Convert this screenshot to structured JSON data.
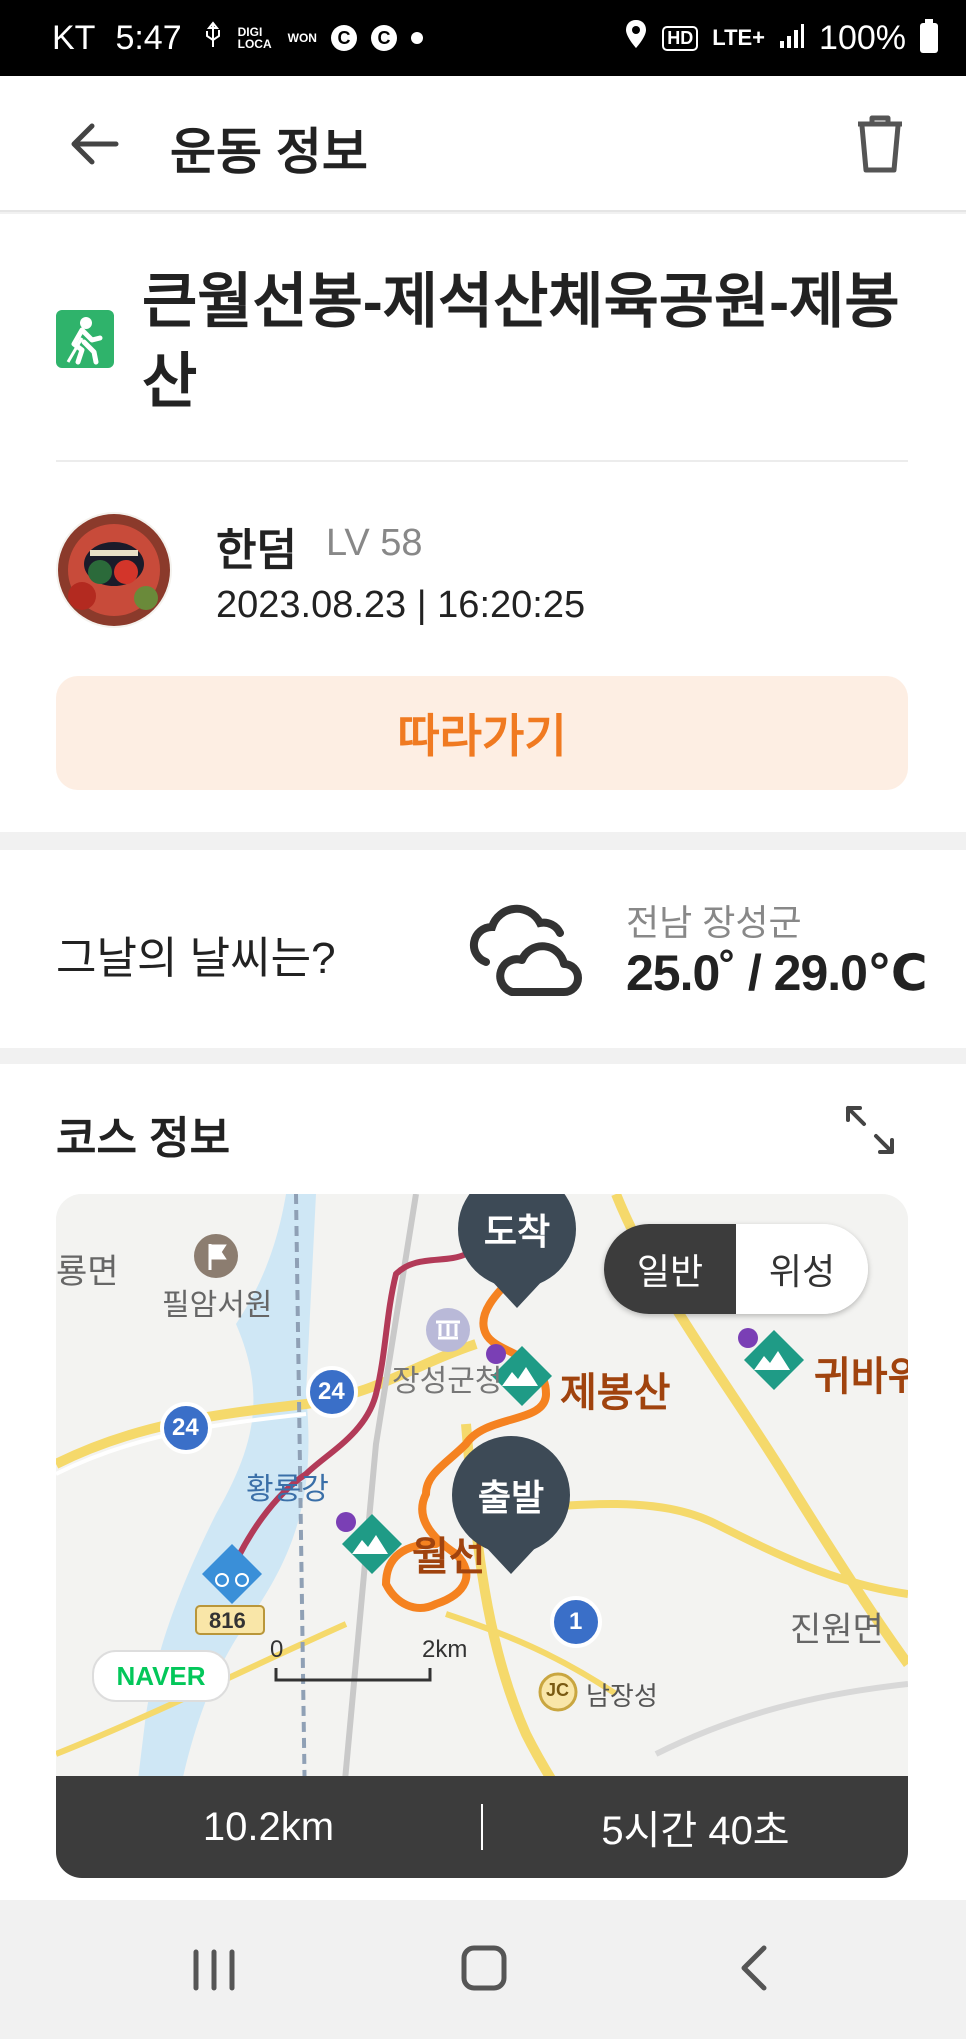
{
  "status_bar": {
    "carrier": "KT",
    "time": "5:47",
    "indicators": [
      "usb-icon",
      "digi-loca-icon",
      "won-icon",
      "c-icon",
      "c-icon"
    ],
    "c_badge": "C",
    "digi_loca": "DIGI LOCA",
    "won": "WON",
    "hd": "HD",
    "network": "LTE+",
    "battery": "100%"
  },
  "header": {
    "title": "운동 정보"
  },
  "activity": {
    "title": "큰월선봉-제석산체육공원-제봉산",
    "user": {
      "name": "한덤",
      "level": "LV 58",
      "datetime": "2023.08.23 | 16:20:25"
    },
    "follow_label": "따라가기"
  },
  "weather": {
    "question": "그날의 날씨는?",
    "location": "전남 장성군",
    "temperature": "25.0˚ / 29.0℃",
    "icon": "cloud-icon"
  },
  "course": {
    "title": "코스 정보",
    "map_toggle": {
      "normal": "일반",
      "satellite": "위성",
      "selected": "일반"
    },
    "pins": {
      "end": "도착",
      "start": "출발"
    },
    "map_labels": {
      "ryongmyeon": "룡면",
      "pilamseowon": "필암서원",
      "jangseonggun": "장성군청",
      "jebongsan": "제봉산",
      "gwibawi": "귀바위",
      "hwangryonggang": "황룡강",
      "wolseon": "월선",
      "jinwonmyeon": "진원면",
      "namjangseong": "남장성",
      "jc": "JC",
      "road_24a": "24",
      "road_24b": "24",
      "road_1": "1",
      "road_816": "816",
      "scale_0": "0",
      "scale_2km": "2km"
    },
    "naver_logo": "NAVER",
    "distance": "10.2km",
    "duration": "5시간 40초"
  },
  "colors": {
    "accent_orange": "#f07a21",
    "follow_bg": "#fdeee3",
    "route_orange": "#f58220",
    "bike_route": "#b23a58",
    "mountain_teal": "#1f9b86",
    "pin_dark": "#3d4a56"
  }
}
